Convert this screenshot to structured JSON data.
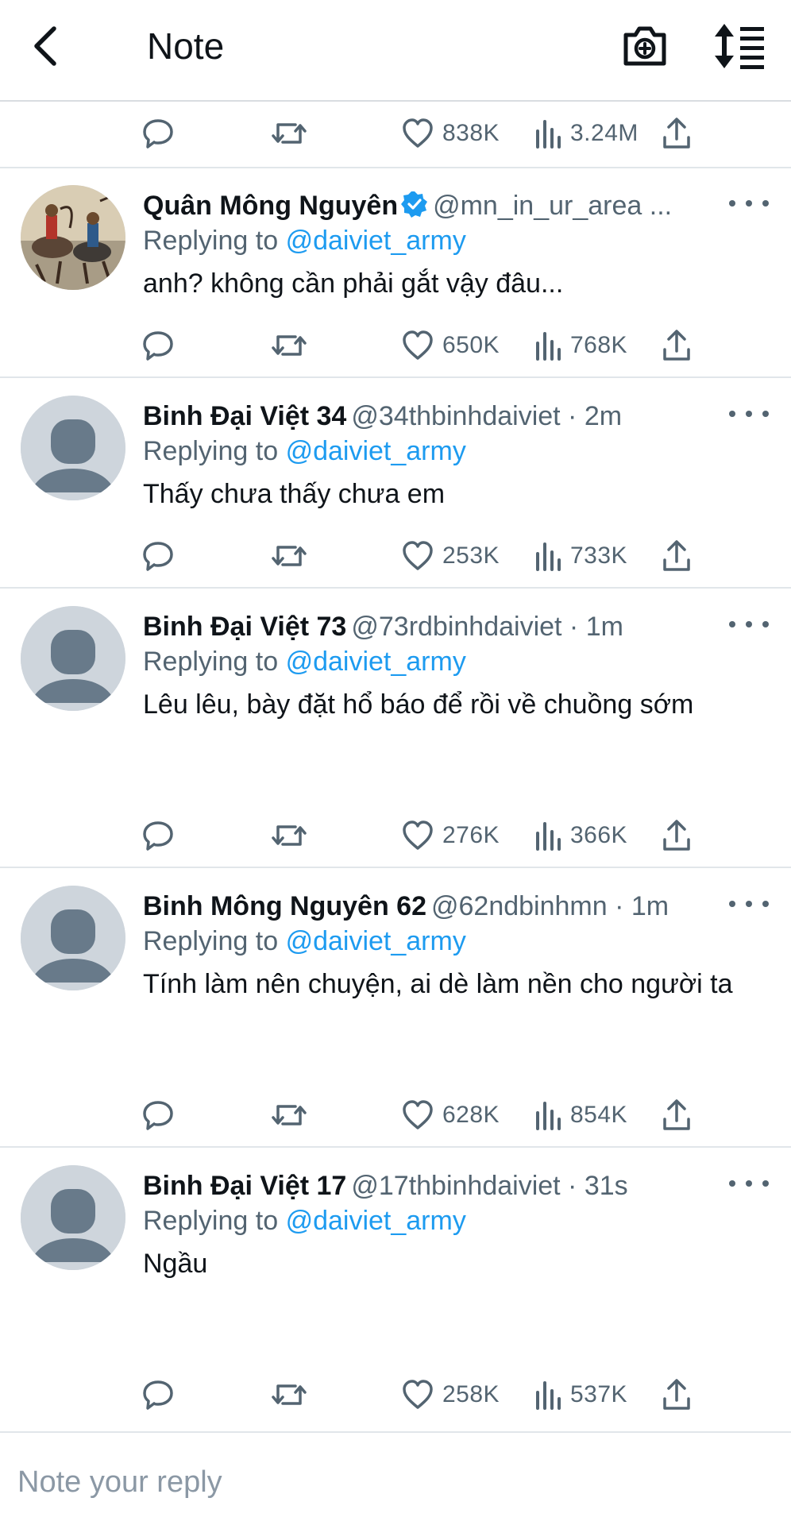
{
  "header": {
    "title": "Note",
    "back_icon": "chevron-left-icon",
    "camera_icon": "camera-add-icon",
    "sort_icon": "sort-list-icon"
  },
  "top_actions": {
    "likes": "838K",
    "views": "3.24M"
  },
  "colors": {
    "link": "#1d9bf0",
    "secondary_text": "#536471",
    "verified": "#1d9bf0",
    "avatar_default": "#ced5dc",
    "avatar_silhouette": "#687a8a"
  },
  "tweets": [
    {
      "name": "Quân Mông Nguyên",
      "verified": true,
      "handle": "@mn_in_ur_area ...",
      "replying_label": "Replying to",
      "replying_to": "@daiviet_army",
      "text": "anh? không cần phải gắt vậy đâu...",
      "likes": "650K",
      "views": "768K",
      "avatar": "painting"
    },
    {
      "name": "Binh Đại Việt 34",
      "verified": false,
      "handle": "@34thbinhdaiviet · 2m",
      "replying_label": "Replying to",
      "replying_to": "@daiviet_army",
      "text": "Thấy chưa thấy chưa em",
      "likes": "253K",
      "views": "733K",
      "avatar": "default"
    },
    {
      "name": "Binh Đại Việt 73",
      "verified": false,
      "handle": "@73rdbinhdaiviet · 1m",
      "replying_label": "Replying to",
      "replying_to": "@daiviet_army",
      "text": "Lêu lêu, bày đặt hổ báo để rồi về chuồng sớm",
      "likes": "276K",
      "views": "366K",
      "avatar": "default"
    },
    {
      "name": "Binh Mông Nguyên 62",
      "verified": false,
      "handle": "@62ndbinhmn · 1m",
      "replying_label": "Replying to",
      "replying_to": "@daiviet_army",
      "text": "Tính làm nên chuyện, ai dè làm nền cho người ta",
      "likes": "628K",
      "views": "854K",
      "avatar": "default"
    },
    {
      "name": "Binh Đại Việt 17",
      "verified": false,
      "handle": "@17thbinhdaiviet · 31s",
      "replying_label": "Replying to",
      "replying_to": "@daiviet_army",
      "text": "Ngầu",
      "likes": "258K",
      "views": "537K",
      "avatar": "default"
    }
  ],
  "reply_bar": {
    "placeholder": "Note your reply"
  }
}
